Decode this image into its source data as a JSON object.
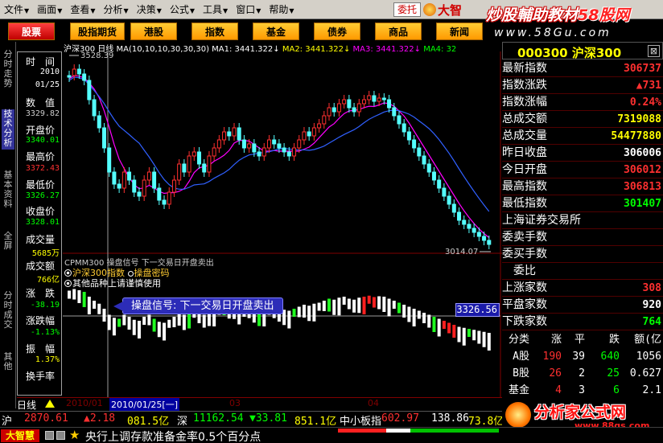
{
  "menu": {
    "items": [
      "文件",
      "画面",
      "查看",
      "分析",
      "决策",
      "公式",
      "工具",
      "窗口",
      "帮助"
    ],
    "entrust": "委托",
    "brand": "大智"
  },
  "watermark": {
    "line1": "炒股輔助教材",
    "line1b": "58股网",
    "line2": "www.58Gu.com"
  },
  "tabs": [
    "股票",
    "股指期货",
    "港股",
    "指数",
    "基金",
    "债券",
    "商品",
    "新闻"
  ],
  "leftnav": [
    "分时走势",
    "技术分析",
    "基本资料",
    "全屏",
    "分时成交",
    "其他"
  ],
  "datawin": {
    "items": [
      {
        "label": "时　间",
        "value": "2010",
        "value2": "01/25",
        "color": "#fff"
      },
      {
        "label": "数　值",
        "value": "3329.82",
        "color": "#ccc"
      },
      {
        "label": "开盘价",
        "value": "3340.01",
        "color": "#00ff00"
      },
      {
        "label": "最高价",
        "value": "3372.43",
        "color": "#ff3030"
      },
      {
        "label": "最低价",
        "value": "3326.27",
        "color": "#00ff00"
      },
      {
        "label": "收盘价",
        "value": "3328.01",
        "color": "#00ff00"
      },
      {
        "label": "成交量",
        "value": "5685万",
        "color": "#ffff00"
      },
      {
        "label": "成交额",
        "value": "766亿",
        "color": "#ffff00"
      },
      {
        "label": "涨　跌",
        "value": "-38.19",
        "color": "#00ff00"
      },
      {
        "label": "涨跌幅",
        "value": "-1.13%",
        "color": "#00ff00"
      },
      {
        "label": "振　幅",
        "value": "1.37%",
        "color": "#ffff00"
      },
      {
        "label": "换手率",
        "value": "",
        "color": "#fff"
      }
    ]
  },
  "chart_header": {
    "name": "沪深300",
    "period": "日线",
    "ma": "MA(10,10,10,30,30,30)",
    "ma1": "MA1: 3441.322",
    "ma2": "MA2: 3441.322",
    "ma3": "MA3: 3441.322",
    "ma4": "MA4: 32"
  },
  "high_tag": "3528.39",
  "low_tag": "3014.07",
  "indicator": {
    "title": "CPMM300  操盘信号  下一交易日开盘卖出",
    "opt1": "沪深300指数",
    "opt1b": "操盘密码",
    "opt2": "其他品种上请谨慎使用",
    "tip": "操盘信号: 下一交易日开盘卖出",
    "price": "3326.56"
  },
  "timeline": {
    "period": "日线",
    "dates": [
      {
        "label": "2010/01",
        "color": "#800000"
      },
      {
        "label": "03",
        "color": "#800000"
      },
      {
        "label": "04",
        "color": "#800000"
      }
    ],
    "cursor": "2010/01/25[一]"
  },
  "right_panel": {
    "code": "000300",
    "name": "沪深300",
    "rows": [
      {
        "label": "最新指数",
        "value": "306737",
        "color": "#ff3030"
      },
      {
        "label": "指数涨跌",
        "value": "▲731",
        "color": "#ff3030"
      },
      {
        "label": "指数涨幅",
        "value": "0.24%",
        "color": "#ff3030"
      },
      {
        "label": "总成交额",
        "value": "7319088",
        "color": "#ffff00"
      },
      {
        "label": "总成交量",
        "value": "54477880",
        "color": "#ffff00"
      },
      {
        "label": "昨日收盘",
        "value": "306006",
        "color": "#fff"
      },
      {
        "label": "今日开盘",
        "value": "306012",
        "color": "#ff3030"
      },
      {
        "label": "最高指数",
        "value": "306813",
        "color": "#ff3030"
      },
      {
        "label": "最低指数",
        "value": "301407",
        "color": "#00ff00"
      },
      {
        "label": "上海证券交易所",
        "value": "",
        "color": "#fff"
      },
      {
        "label": "委卖手数",
        "value": "",
        "color": "#fff"
      },
      {
        "label": "委买手数",
        "value": "",
        "color": "#fff"
      },
      {
        "label": "　委比",
        "value": "",
        "color": "#fff"
      },
      {
        "label": "上涨家数",
        "value": "308",
        "color": "#ff3030"
      },
      {
        "label": "平盘家数",
        "value": "920",
        "color": "#fff"
      },
      {
        "label": "下跌家数",
        "value": "764",
        "color": "#00ff00"
      }
    ],
    "table_header": [
      "分类",
      "涨",
      "平",
      "跌",
      "额(亿"
    ],
    "table_rows": [
      [
        "A股",
        "190",
        "39",
        "640",
        "1056"
      ],
      [
        "B股",
        "26",
        "2",
        "25",
        "0.627"
      ],
      [
        "基金",
        "4",
        "3",
        "6",
        "2.1"
      ]
    ]
  },
  "logo": {
    "text": "分析家公式网",
    "url": "www.88gs.com"
  },
  "status1": [
    {
      "text": "沪",
      "color": "#fff"
    },
    {
      "text": "2870.61",
      "color": "#ff3030"
    },
    {
      "text": "▲2.18",
      "color": "#ff3030"
    },
    {
      "text": "081.5亿",
      "color": "#ffff00"
    },
    {
      "text": "深",
      "color": "#fff"
    },
    {
      "text": "11162.54",
      "color": "#00ff00"
    },
    {
      "text": "▼33.81",
      "color": "#00ff00"
    },
    {
      "text": "851.1亿",
      "color": "#ffff00"
    },
    {
      "text": "中小板指",
      "color": "#fff"
    },
    {
      "text": "602.97",
      "color": "#ff3030"
    },
    {
      "text": "138.86",
      "color": "#fff"
    },
    {
      "text": "73.8亿",
      "color": "#ffff00"
    }
  ],
  "status2": {
    "badge": "大智慧",
    "news": "央行上调存款准备金率0.5个百分点"
  }
}
